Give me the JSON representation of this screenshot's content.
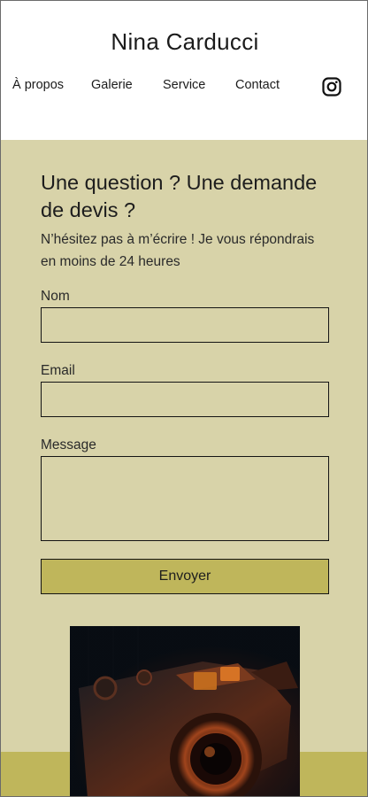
{
  "site": {
    "title": "Nina Carducci"
  },
  "nav": {
    "items": [
      {
        "label": "À propos"
      },
      {
        "label": "Galerie"
      },
      {
        "label": "Service"
      },
      {
        "label": "Contact"
      }
    ],
    "social_icon": "instagram-icon"
  },
  "contact": {
    "heading": "Une question ? Une demande de devis ?",
    "intro": "N’hésitez pas à m’écrire ! Je vous répondrais en moins de 24 heures",
    "fields": {
      "name_label": "Nom",
      "name_value": "",
      "email_label": "Email",
      "email_value": "",
      "message_label": "Message",
      "message_value": ""
    },
    "submit_label": "Envoyer"
  },
  "colors": {
    "section_bg": "#d8d3a9",
    "accent": "#bfb65b",
    "text": "#1d1d1d"
  }
}
